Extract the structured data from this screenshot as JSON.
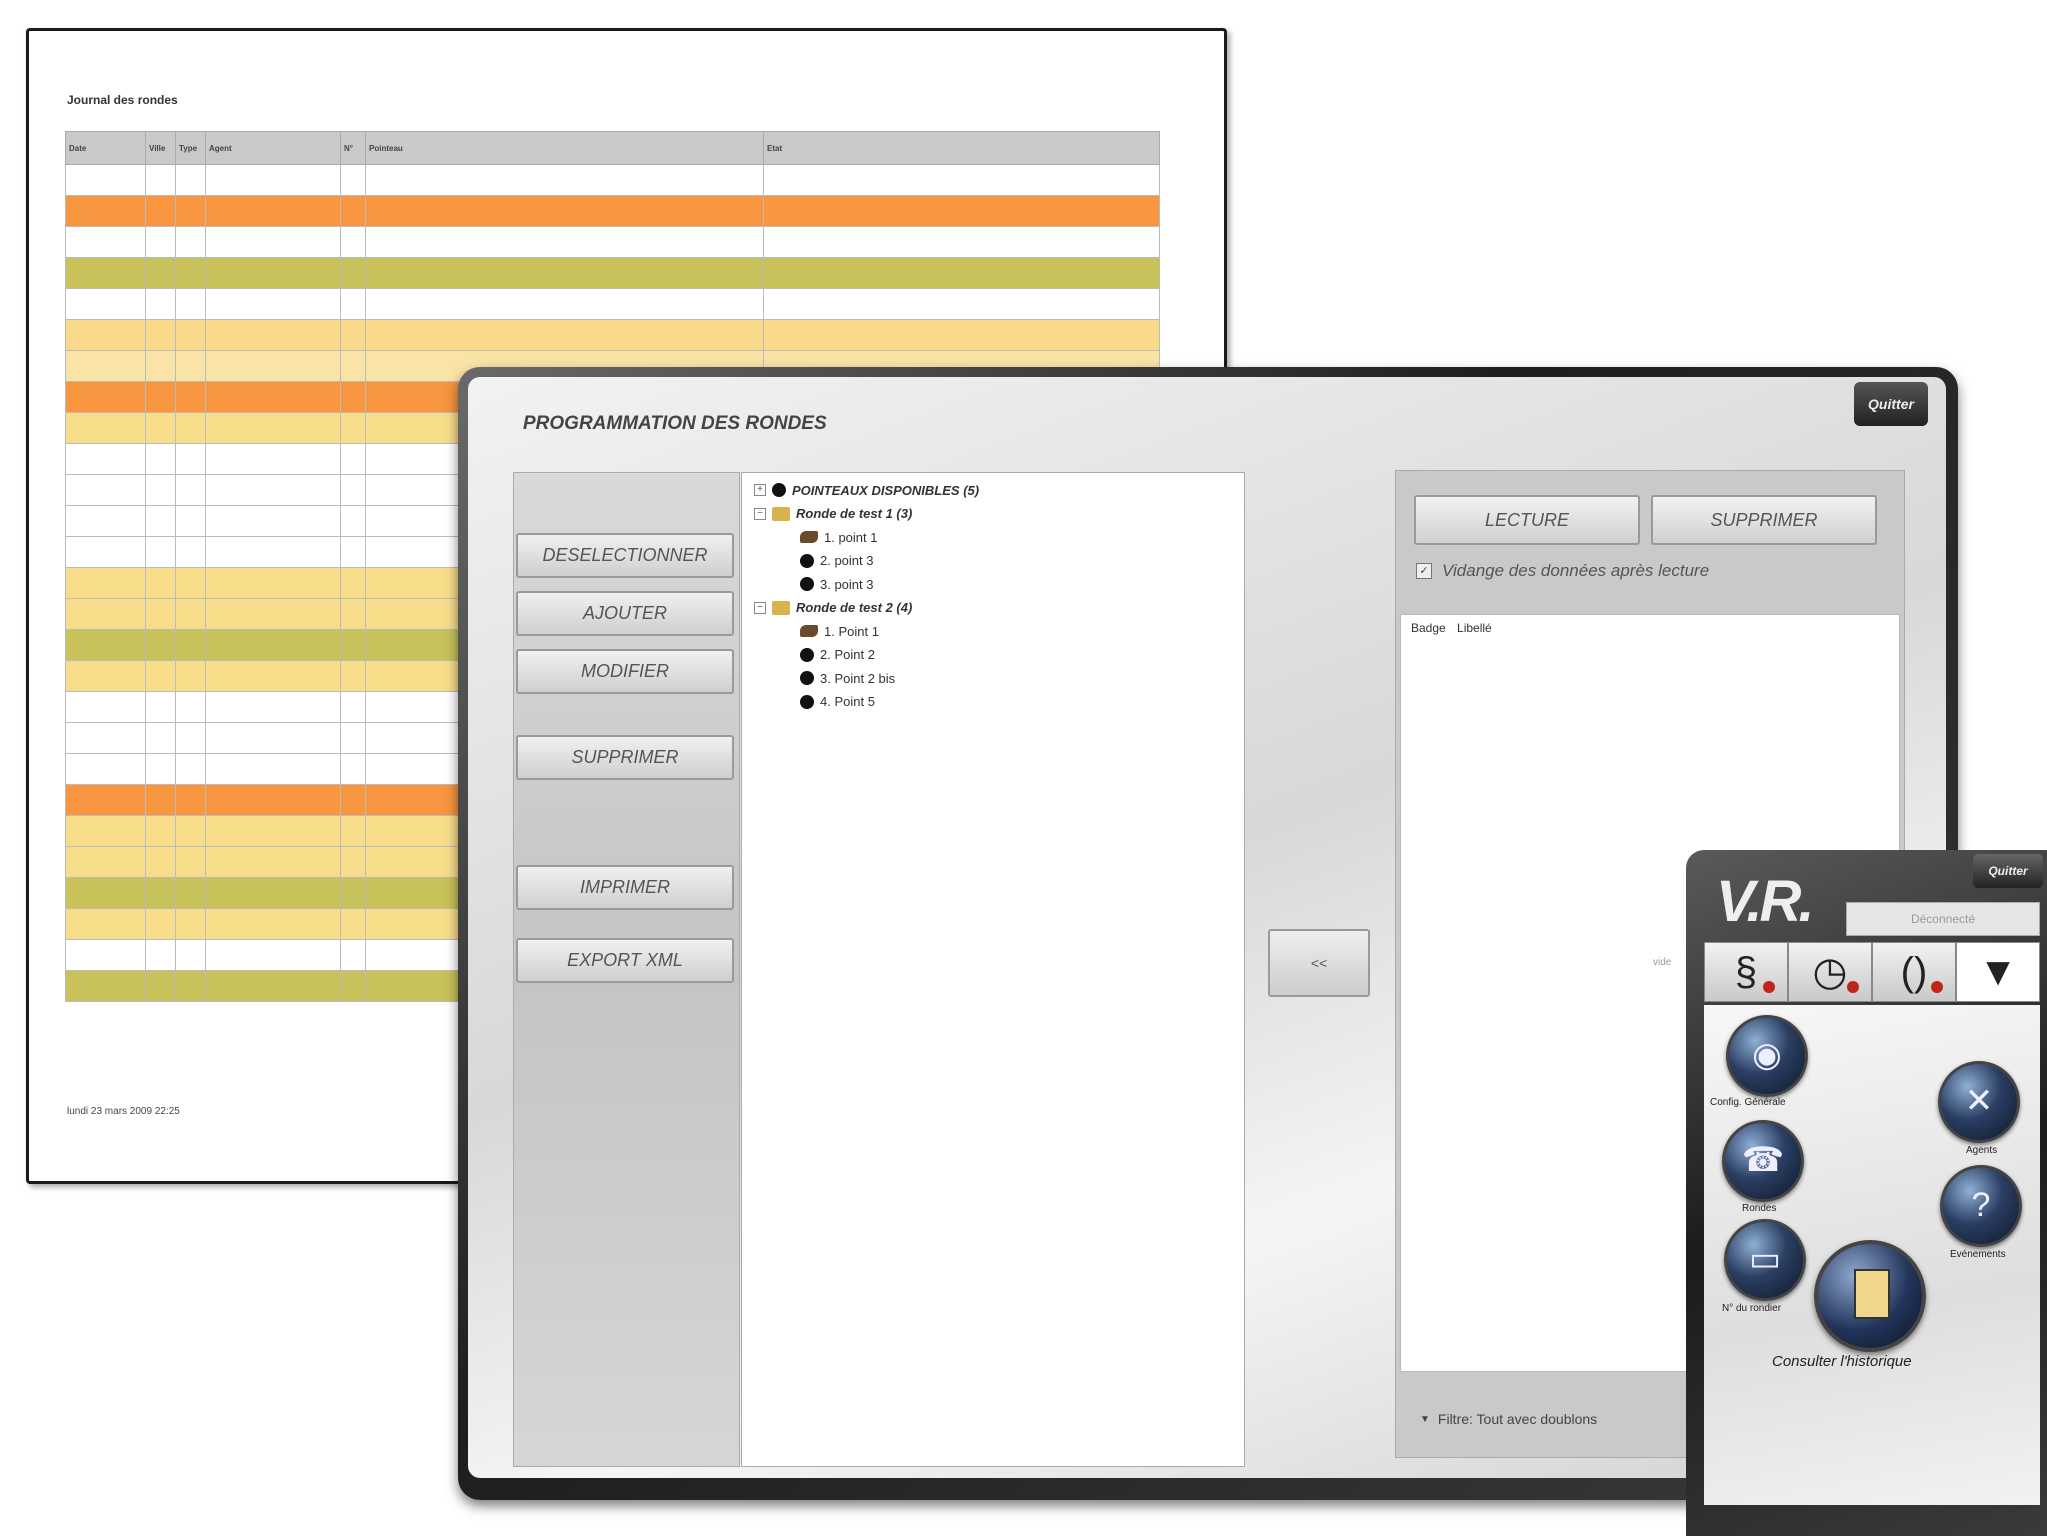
{
  "report": {
    "title": "Journal des rondes",
    "headers": [
      "Date",
      "Ville",
      "Type",
      "Agent",
      "N°",
      "Pointeau",
      "Etat"
    ],
    "rows": [
      {
        "cells": [
          "",
          "",
          "",
          "",
          "",
          "",
          ""
        ],
        "color": "#ffffff"
      },
      {
        "cells": [
          "",
          "",
          "",
          "",
          "",
          "",
          ""
        ],
        "color": "#f7963f"
      },
      {
        "cells": [
          "",
          "",
          "",
          "",
          "",
          "",
          ""
        ],
        "color": "#ffffff"
      },
      {
        "cells": [
          "",
          "",
          "",
          "",
          "",
          "",
          ""
        ],
        "color": "#c7c35a"
      },
      {
        "cells": [
          "",
          "",
          "",
          "",
          "",
          "",
          ""
        ],
        "color": "#ffffff"
      },
      {
        "cells": [
          "",
          "",
          "",
          "",
          "",
          "",
          ""
        ],
        "color": "#fbd98a"
      },
      {
        "cells": [
          "",
          "",
          "",
          "",
          "",
          "",
          ""
        ],
        "color": "#f9e3a5"
      },
      {
        "cells": [
          "",
          "",
          "",
          "",
          "",
          "",
          ""
        ],
        "color": "#f7963f"
      },
      {
        "cells": [
          "",
          "",
          "",
          "",
          "",
          "",
          ""
        ],
        "color": "#f7dc8a"
      },
      {
        "cells": [
          "",
          "",
          "",
          "",
          "",
          "",
          ""
        ],
        "color": "#ffffff"
      },
      {
        "cells": [
          "",
          "",
          "",
          "",
          "",
          "",
          ""
        ],
        "color": "#ffffff"
      },
      {
        "cells": [
          "",
          "",
          "",
          "",
          "",
          "",
          ""
        ],
        "color": "#ffffff"
      },
      {
        "cells": [
          "",
          "",
          "",
          "",
          "",
          "",
          ""
        ],
        "color": "#ffffff"
      },
      {
        "cells": [
          "",
          "",
          "",
          "",
          "",
          "",
          ""
        ],
        "color": "#f7dc8a"
      },
      {
        "cells": [
          "",
          "",
          "",
          "",
          "",
          "",
          ""
        ],
        "color": "#f7dc8a"
      },
      {
        "cells": [
          "",
          "",
          "",
          "",
          "",
          "",
          ""
        ],
        "color": "#c7c35a"
      },
      {
        "cells": [
          "",
          "",
          "",
          "",
          "",
          "",
          ""
        ],
        "color": "#f7dc8a"
      },
      {
        "cells": [
          "",
          "",
          "",
          "",
          "",
          "",
          ""
        ],
        "color": "#ffffff"
      },
      {
        "cells": [
          "",
          "",
          "",
          "",
          "",
          "",
          ""
        ],
        "color": "#ffffff"
      },
      {
        "cells": [
          "",
          "",
          "",
          "",
          "",
          "",
          ""
        ],
        "color": "#ffffff"
      },
      {
        "cells": [
          "",
          "",
          "",
          "",
          "",
          "",
          ""
        ],
        "color": "#f7963f"
      },
      {
        "cells": [
          "",
          "",
          "",
          "",
          "",
          "",
          ""
        ],
        "color": "#f7dc8a"
      },
      {
        "cells": [
          "",
          "",
          "",
          "",
          "",
          "",
          ""
        ],
        "color": "#f7dc8a"
      },
      {
        "cells": [
          "",
          "",
          "",
          "",
          "",
          "",
          ""
        ],
        "color": "#c7c35a"
      },
      {
        "cells": [
          "",
          "",
          "",
          "",
          "",
          "",
          ""
        ],
        "color": "#f7dc8a"
      },
      {
        "cells": [
          "",
          "",
          "",
          "",
          "",
          "",
          ""
        ],
        "color": "#ffffff"
      },
      {
        "cells": [
          "",
          "",
          "",
          "",
          "",
          "",
          ""
        ],
        "color": "#c7c35a"
      }
    ],
    "footer": "lundi 23 mars 2009 22:25"
  },
  "main_window": {
    "title": "PROGRAMMATION DES RONDES",
    "close_label": "Quitter",
    "buttons": {
      "deselect": "DESELECTIONNER",
      "add": "AJOUTER",
      "modify": "MODIFIER",
      "delete": "SUPPRIMER",
      "print": "IMPRIMER",
      "export": "EXPORT XML"
    },
    "tree": [
      {
        "label": "POINTEAUX DISPONIBLES (5)",
        "icon": "dot-icon",
        "level": 0,
        "expander": "+"
      },
      {
        "label": "Ronde de test 1 (3)",
        "icon": "folder-icon",
        "level": 0,
        "expander": "−"
      },
      {
        "label": "1. point 1",
        "icon": "hand-icon",
        "level": 1
      },
      {
        "label": "2. point 3",
        "icon": "dot-icon",
        "level": 1
      },
      {
        "label": "3. point 3",
        "icon": "dot-icon",
        "level": 1
      },
      {
        "label": "Ronde de test 2 (4)",
        "icon": "folder-icon",
        "level": 0,
        "expander": "−"
      },
      {
        "label": "1. Point 1",
        "icon": "hand-icon",
        "level": 1
      },
      {
        "label": "2. Point 2",
        "icon": "dot-icon",
        "level": 1
      },
      {
        "label": "3. Point 2 bis",
        "icon": "dot-icon",
        "level": 1
      },
      {
        "label": "4. Point 5",
        "icon": "dot-icon",
        "level": 1
      }
    ],
    "transfer_label": "<<",
    "right": {
      "read_label": "LECTURE",
      "delete_label": "SUPPRIMER",
      "purge_label": "Vidange des données après lecture",
      "purge_checked": true,
      "list_header": "Badge Libellé",
      "list_empty": "vide",
      "filter_label": "Filtre: Tout avec doublons"
    }
  },
  "vr_panel": {
    "logo": "V.R.",
    "badge": "Quitter",
    "field_placeholder": "Déconnecté",
    "tabs": [
      {
        "icon": "phone-icon",
        "glyph": "§",
        "alert": true
      },
      {
        "icon": "clock-icon",
        "glyph": "◷",
        "alert": true
      },
      {
        "icon": "radio-icon",
        "glyph": "()",
        "alert": true
      },
      {
        "icon": "gun-icon",
        "glyph": "▼",
        "alert": false
      }
    ],
    "actions": {
      "config": "Config. Générale",
      "agents": "Agents",
      "rondes": "Rondes",
      "events": "Evénements",
      "intervention": "N° du rondier",
      "history": "Consulter l'historique"
    }
  }
}
